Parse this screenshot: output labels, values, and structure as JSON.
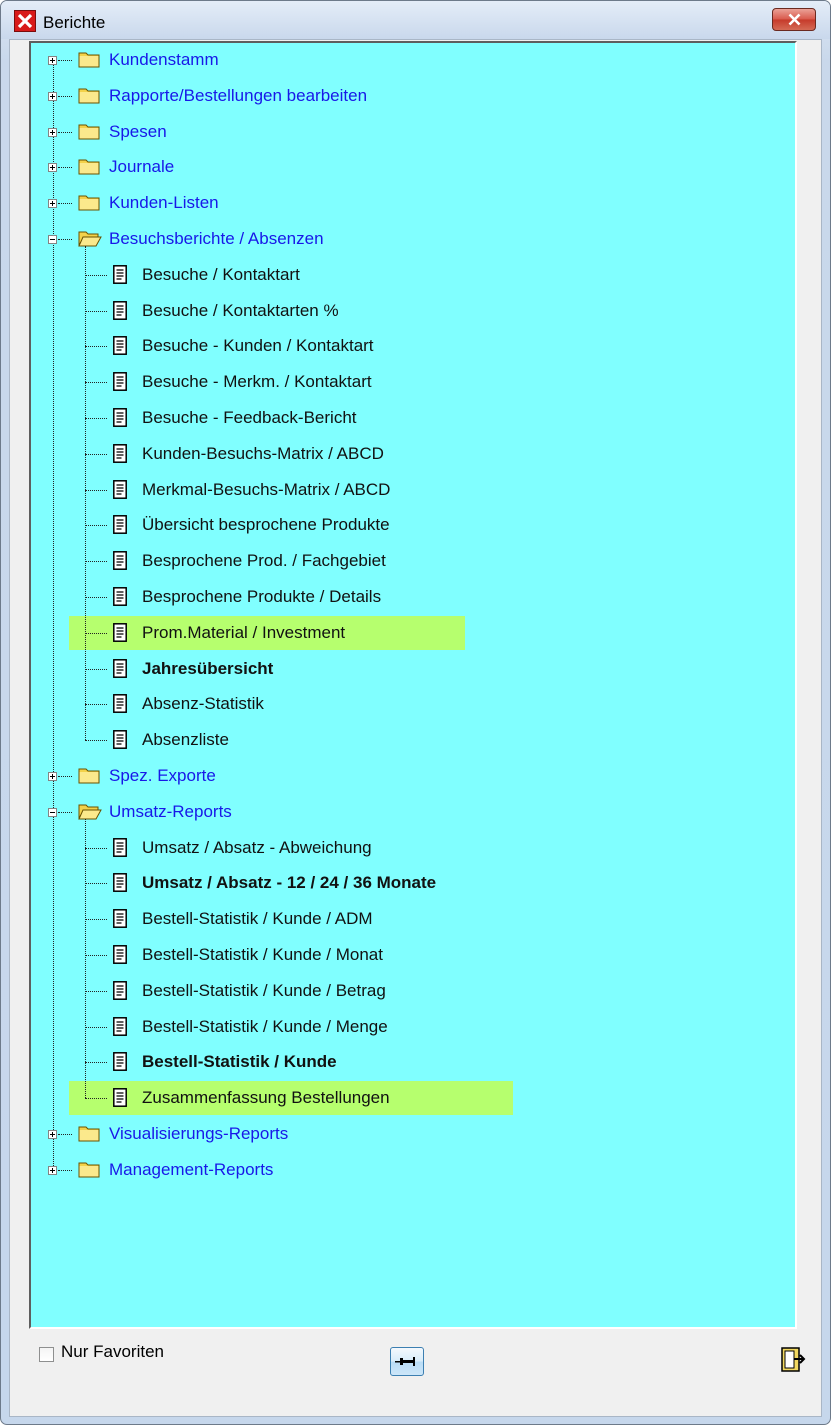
{
  "window": {
    "title": "Berichte"
  },
  "tree": {
    "categories": [
      {
        "label": "Kundenstamm",
        "expanded": false
      },
      {
        "label": "Rapporte/Bestellungen bearbeiten",
        "expanded": false
      },
      {
        "label": "Spesen",
        "expanded": false
      },
      {
        "label": "Journale",
        "expanded": false
      },
      {
        "label": "Kunden-Listen",
        "expanded": false
      },
      {
        "label": "Besuchsberichte / Absenzen",
        "expanded": true,
        "items": [
          {
            "label": "Besuche / Kontaktart"
          },
          {
            "label": "Besuche / Kontaktarten %"
          },
          {
            "label": "Besuche - Kunden / Kontaktart"
          },
          {
            "label": "Besuche - Merkm. / Kontaktart"
          },
          {
            "label": "Besuche - Feedback-Bericht"
          },
          {
            "label": "Kunden-Besuchs-Matrix / ABCD"
          },
          {
            "label": "Merkmal-Besuchs-Matrix / ABCD"
          },
          {
            "label": "Übersicht besprochene Produkte"
          },
          {
            "label": "Besprochene Prod. / Fachgebiet"
          },
          {
            "label": "Besprochene Produkte / Details"
          },
          {
            "label": "Prom.Material / Investment",
            "highlighted": true
          },
          {
            "label": "Jahresübersicht",
            "bold": true
          },
          {
            "label": "Absenz-Statistik"
          },
          {
            "label": "Absenzliste"
          }
        ]
      },
      {
        "label": "Spez. Exporte",
        "expanded": false
      },
      {
        "label": "Umsatz-Reports",
        "expanded": true,
        "items": [
          {
            "label": "Umsatz / Absatz - Abweichung"
          },
          {
            "label": "Umsatz / Absatz - 12 / 24 / 36 Monate",
            "bold": true
          },
          {
            "label": "Bestell-Statistik / Kunde / ADM"
          },
          {
            "label": "Bestell-Statistik / Kunde / Monat"
          },
          {
            "label": "Bestell-Statistik / Kunde / Betrag"
          },
          {
            "label": "Bestell-Statistik / Kunde / Menge"
          },
          {
            "label": "Bestell-Statistik / Kunde",
            "bold": true
          },
          {
            "label": "Zusammenfassung Bestellungen",
            "highlighted": true
          }
        ]
      },
      {
        "label": "Visualisierungs-Reports",
        "expanded": false
      },
      {
        "label": "Management-Reports",
        "expanded": false
      }
    ]
  },
  "footer": {
    "favorites_label": "Nur Favoriten",
    "favorites_checked": false,
    "pin_icon": "pin-icon",
    "exit_icon": "exit-door-icon"
  },
  "colors": {
    "tree_background": "#80ffff",
    "category_text": "#1818e8",
    "highlight": "#b6ff6e",
    "folder": "#f3d24a"
  }
}
